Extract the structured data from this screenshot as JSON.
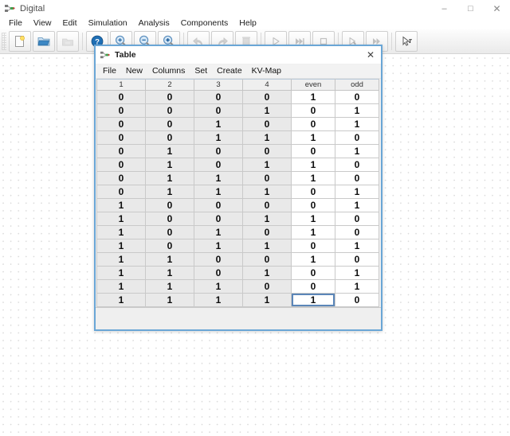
{
  "window": {
    "title": "Digital",
    "icon": "digital-app-icon",
    "controls": {
      "minimize": "–",
      "maximize": "□",
      "close": "✕"
    }
  },
  "menubar": {
    "items": [
      {
        "label": "File"
      },
      {
        "label": "View"
      },
      {
        "label": "Edit"
      },
      {
        "label": "Simulation"
      },
      {
        "label": "Analysis"
      },
      {
        "label": "Components"
      },
      {
        "label": "Help"
      }
    ]
  },
  "toolbar": {
    "groups": [
      {
        "buttons": [
          {
            "name": "new-file-button",
            "icon": "new-document-icon"
          },
          {
            "name": "open-file-button",
            "icon": "open-folder-icon"
          },
          {
            "name": "save-file-button",
            "icon": "save-disk-icon",
            "disabled": true
          }
        ]
      },
      {
        "buttons": [
          {
            "name": "help-button",
            "icon": "help-question-icon"
          },
          {
            "name": "zoom-in-button",
            "icon": "zoom-in-icon"
          },
          {
            "name": "zoom-out-button",
            "icon": "zoom-out-icon"
          },
          {
            "name": "zoom-fit-button",
            "icon": "zoom-fit-icon"
          }
        ]
      },
      {
        "buttons": [
          {
            "name": "undo-button",
            "icon": "undo-arrow-icon",
            "disabled": true
          },
          {
            "name": "redo-button",
            "icon": "redo-arrow-icon",
            "disabled": true
          },
          {
            "name": "delete-button",
            "icon": "trash-icon",
            "disabled": true
          }
        ]
      },
      {
        "buttons": [
          {
            "name": "run-button",
            "icon": "play-icon",
            "disabled": true
          },
          {
            "name": "run-fast-button",
            "icon": "fast-forward-icon",
            "disabled": true
          },
          {
            "name": "stop-button",
            "icon": "stop-square-icon",
            "disabled": true
          }
        ]
      },
      {
        "buttons": [
          {
            "name": "step-button",
            "icon": "step-cursor-icon",
            "disabled": true
          },
          {
            "name": "run-to-break-button",
            "icon": "double-arrow-icon",
            "disabled": true
          }
        ]
      },
      {
        "buttons": [
          {
            "name": "measure-cursor-button",
            "icon": "text-cursor-icon"
          }
        ]
      }
    ]
  },
  "dialog": {
    "title": "Table",
    "icon": "table-window-icon",
    "close_label": "✕",
    "menu": [
      {
        "label": "File"
      },
      {
        "label": "New"
      },
      {
        "label": "Columns"
      },
      {
        "label": "Set"
      },
      {
        "label": "Create"
      },
      {
        "label": "KV-Map"
      }
    ],
    "table": {
      "columns": [
        {
          "label": "1",
          "kind": "input"
        },
        {
          "label": "2",
          "kind": "input"
        },
        {
          "label": "3",
          "kind": "input"
        },
        {
          "label": "4",
          "kind": "input"
        },
        {
          "label": "even",
          "kind": "output"
        },
        {
          "label": "odd",
          "kind": "output"
        }
      ],
      "rows": [
        [
          "0",
          "0",
          "0",
          "0",
          "1",
          "0"
        ],
        [
          "0",
          "0",
          "0",
          "1",
          "0",
          "1"
        ],
        [
          "0",
          "0",
          "1",
          "0",
          "0",
          "1"
        ],
        [
          "0",
          "0",
          "1",
          "1",
          "1",
          "0"
        ],
        [
          "0",
          "1",
          "0",
          "0",
          "0",
          "1"
        ],
        [
          "0",
          "1",
          "0",
          "1",
          "1",
          "0"
        ],
        [
          "0",
          "1",
          "1",
          "0",
          "1",
          "0"
        ],
        [
          "0",
          "1",
          "1",
          "1",
          "0",
          "1"
        ],
        [
          "1",
          "0",
          "0",
          "0",
          "0",
          "1"
        ],
        [
          "1",
          "0",
          "0",
          "1",
          "1",
          "0"
        ],
        [
          "1",
          "0",
          "1",
          "0",
          "1",
          "0"
        ],
        [
          "1",
          "0",
          "1",
          "1",
          "0",
          "1"
        ],
        [
          "1",
          "1",
          "0",
          "0",
          "1",
          "0"
        ],
        [
          "1",
          "1",
          "0",
          "1",
          "0",
          "1"
        ],
        [
          "1",
          "1",
          "1",
          "0",
          "0",
          "1"
        ],
        [
          "1",
          "1",
          "1",
          "1",
          "1",
          "0"
        ]
      ],
      "selected_cell": {
        "row": 15,
        "col": 4
      }
    }
  },
  "colors": {
    "dialog_border": "#6aa6d6",
    "selection_border": "#5b86b8",
    "input_cell_bg": "#e9e9e9",
    "output_cell_bg": "#ffffff",
    "header_bg": "#efefef",
    "canvas_dot": "#d9d9d9"
  }
}
